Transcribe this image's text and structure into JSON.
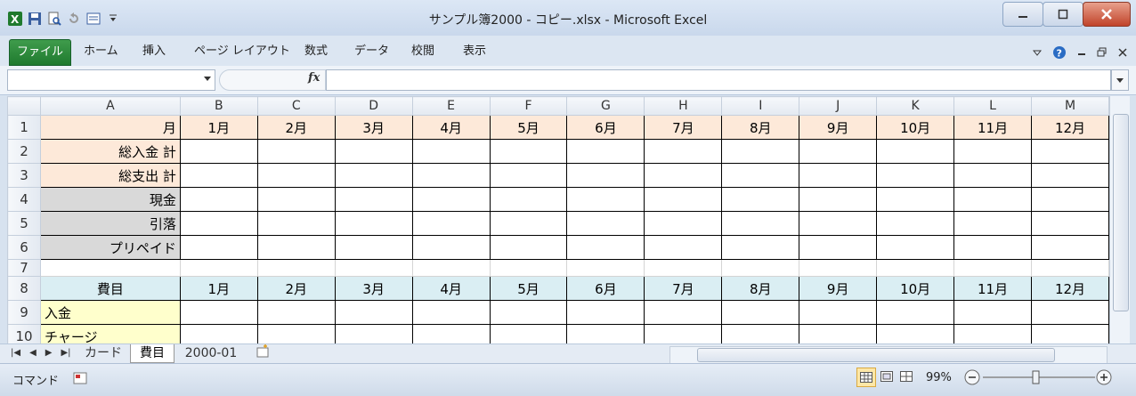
{
  "window": {
    "title": "サンプル簿2000 - コピー.xlsx - Microsoft Excel"
  },
  "ribbon": {
    "tabs": [
      {
        "label": "ファイル"
      },
      {
        "label": "ホーム"
      },
      {
        "label": "挿入"
      },
      {
        "label": "ページ レイアウト"
      },
      {
        "label": "数式"
      },
      {
        "label": "データ"
      },
      {
        "label": "校閲"
      },
      {
        "label": "表示"
      }
    ]
  },
  "formula_bar": {
    "name_box": "",
    "fx_label": "fx",
    "content": ""
  },
  "grid": {
    "columns": [
      "A",
      "B",
      "C",
      "D",
      "E",
      "F",
      "G",
      "H",
      "I",
      "J",
      "K",
      "L",
      "M"
    ],
    "rows": [
      {
        "num": "1",
        "cells": [
          "月",
          "1月",
          "2月",
          "3月",
          "4月",
          "5月",
          "6月",
          "7月",
          "8月",
          "9月",
          "10月",
          "11月",
          "12月"
        ]
      },
      {
        "num": "2",
        "cells": [
          "総入金 計",
          "",
          "",
          "",
          "",
          "",
          "",
          "",
          "",
          "",
          "",
          "",
          ""
        ]
      },
      {
        "num": "3",
        "cells": [
          "総支出 計",
          "",
          "",
          "",
          "",
          "",
          "",
          "",
          "",
          "",
          "",
          "",
          ""
        ]
      },
      {
        "num": "4",
        "cells": [
          "現金",
          "",
          "",
          "",
          "",
          "",
          "",
          "",
          "",
          "",
          "",
          "",
          ""
        ]
      },
      {
        "num": "5",
        "cells": [
          "引落",
          "",
          "",
          "",
          "",
          "",
          "",
          "",
          "",
          "",
          "",
          "",
          ""
        ]
      },
      {
        "num": "6",
        "cells": [
          "プリペイド",
          "",
          "",
          "",
          "",
          "",
          "",
          "",
          "",
          "",
          "",
          "",
          ""
        ]
      },
      {
        "num": "7",
        "cells": [
          "",
          "",
          "",
          "",
          "",
          "",
          "",
          "",
          "",
          "",
          "",
          "",
          ""
        ]
      },
      {
        "num": "8",
        "cells": [
          "費目",
          "1月",
          "2月",
          "3月",
          "4月",
          "5月",
          "6月",
          "7月",
          "8月",
          "9月",
          "10月",
          "11月",
          "12月"
        ]
      },
      {
        "num": "9",
        "cells": [
          "入金",
          "",
          "",
          "",
          "",
          "",
          "",
          "",
          "",
          "",
          "",
          "",
          ""
        ]
      },
      {
        "num": "10",
        "cells": [
          "チャージ",
          "",
          "",
          "",
          "",
          "",
          "",
          "",
          "",
          "",
          "",
          "",
          ""
        ]
      }
    ]
  },
  "sheets": {
    "tabs": [
      {
        "label": "カード"
      },
      {
        "label": "費目"
      },
      {
        "label": "2000-01"
      }
    ],
    "active": "費目"
  },
  "status": {
    "mode": "コマンド",
    "zoom": "99%",
    "zoom_minus": "−",
    "zoom_plus": "+"
  },
  "colors": {
    "file_tab": "#1f7a2e",
    "peach": "#fde9d9",
    "grey": "#d9d9d9",
    "blue": "#daeef3",
    "yellow": "#ffffcc"
  }
}
